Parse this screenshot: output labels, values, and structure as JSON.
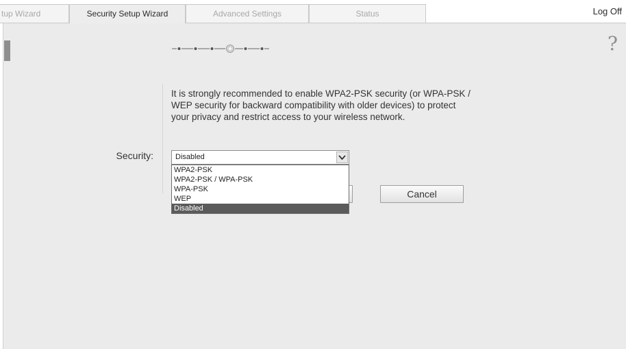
{
  "tabs": [
    {
      "label": "tup Wizard",
      "active": false
    },
    {
      "label": "Security Setup Wizard",
      "active": true
    },
    {
      "label": "Advanced Settings",
      "active": false
    },
    {
      "label": "Status",
      "active": false
    }
  ],
  "header": {
    "logoff_label": "Log Off"
  },
  "help": {
    "glyph": "?"
  },
  "progress": {
    "steps": 6,
    "current_step": 4
  },
  "info_text": "It is strongly recommended to enable WPA2-PSK security (or WPA-PSK / WEP security for backward compatibility with older devices) to protect your privacy and restrict access to your wireless network.",
  "security": {
    "label": "Security:",
    "selected_value": "Disabled",
    "options": [
      "WPA2-PSK",
      "WPA2-PSK / WPA-PSK",
      "WPA-PSK",
      "WEP",
      "Disabled"
    ],
    "highlighted_option": "Disabled"
  },
  "buttons": {
    "cancel_label": "Cancel"
  },
  "colors": {
    "panel_bg": "#ebebeb",
    "highlight": "#5b5b5b",
    "tab_inactive_text": "#a8a8a8"
  }
}
